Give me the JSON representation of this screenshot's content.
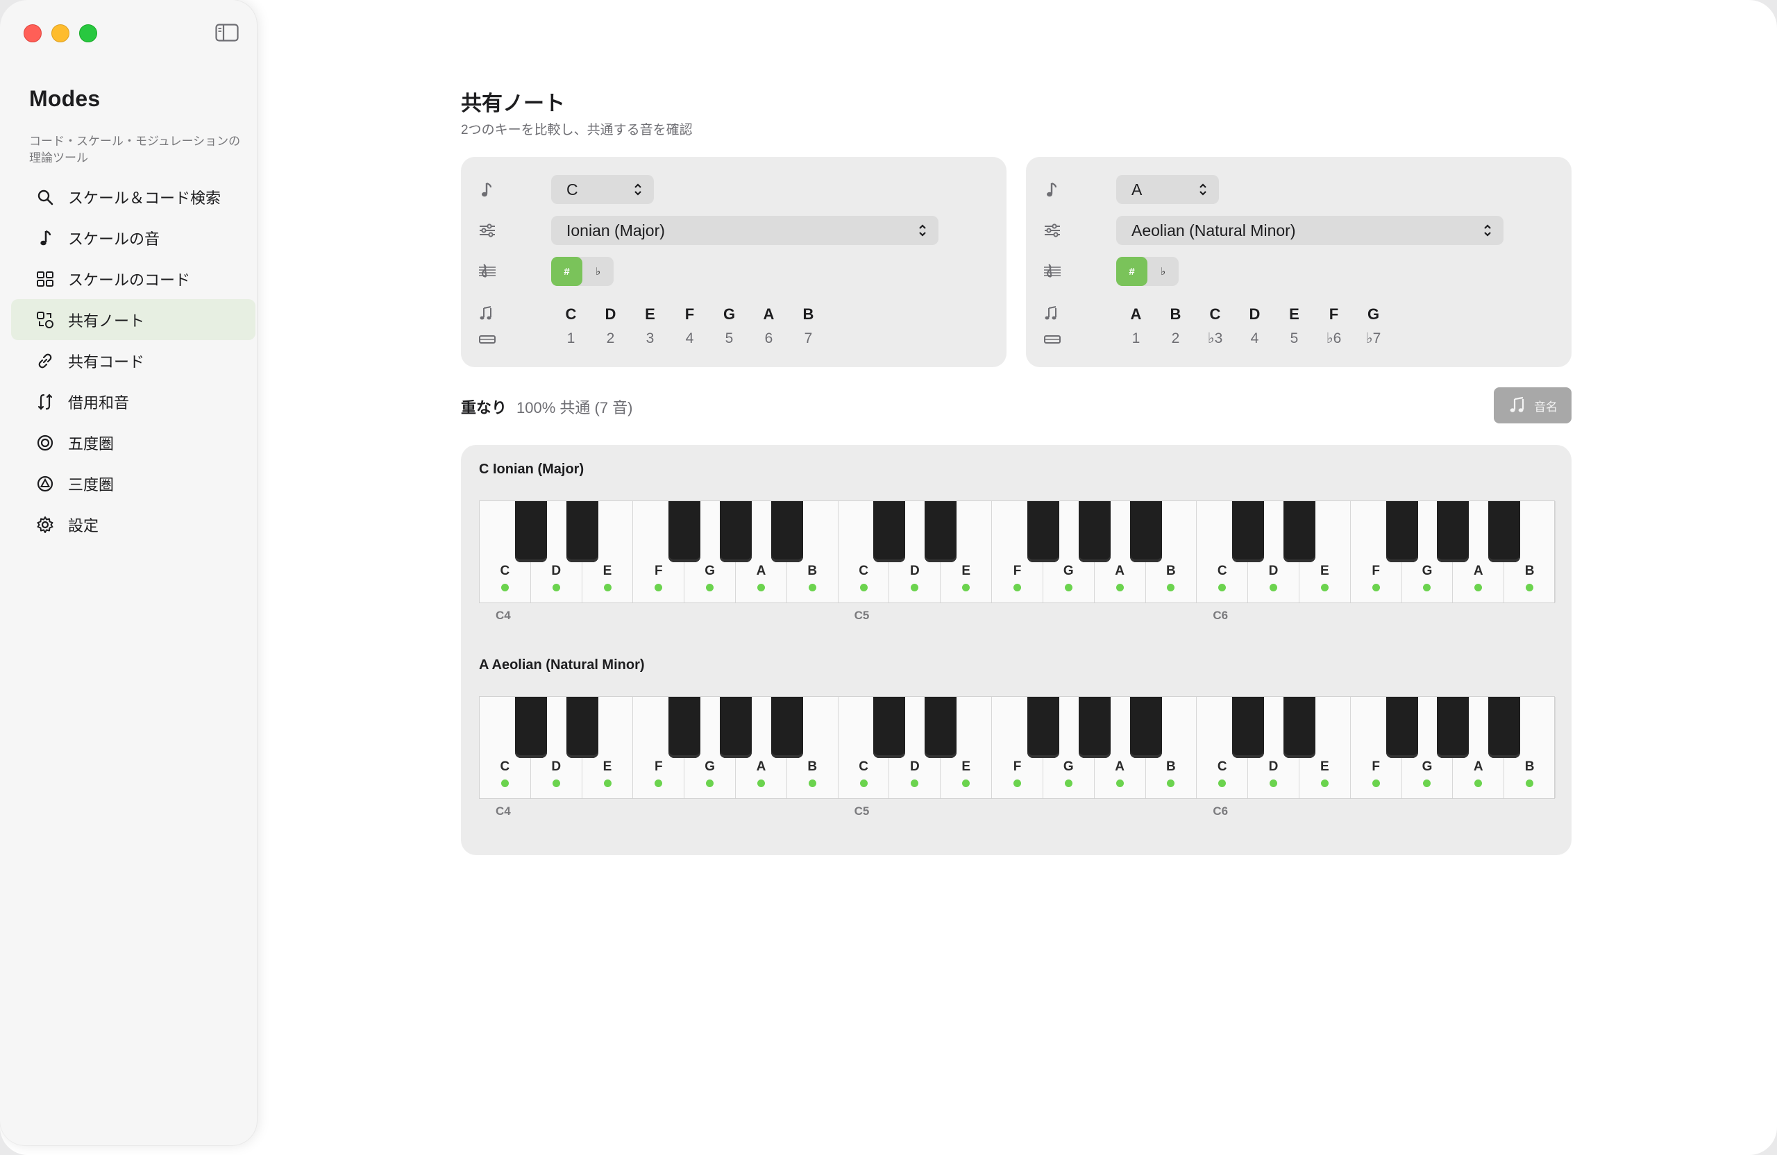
{
  "app": {
    "title": "Modes",
    "subtitle": "コード・スケール・モジュレーションの理論ツール"
  },
  "sidebar": {
    "items": [
      {
        "label": "スケール＆コード検索",
        "icon": "search-icon"
      },
      {
        "label": "スケールの音",
        "icon": "music-note-icon"
      },
      {
        "label": "スケールのコード",
        "icon": "grid-icon"
      },
      {
        "label": "共有ノート",
        "icon": "shared-shapes-icon",
        "active": true
      },
      {
        "label": "共有コード",
        "icon": "link-icon"
      },
      {
        "label": "借用和音",
        "icon": "swap-arrows-icon"
      },
      {
        "label": "五度圏",
        "icon": "circle-target-icon"
      },
      {
        "label": "三度圏",
        "icon": "triangle-circle-icon"
      },
      {
        "label": "設定",
        "icon": "gear-icon"
      }
    ]
  },
  "main": {
    "title": "共有ノート",
    "subtitle": "2つのキーを比較し、共通する音を確認"
  },
  "key_left": {
    "root": "C",
    "mode": "Ionian (Major)",
    "sharp_label": "#",
    "flat_label": "♭",
    "notes": [
      "C",
      "D",
      "E",
      "F",
      "G",
      "A",
      "B"
    ],
    "degrees": [
      "1",
      "2",
      "3",
      "4",
      "5",
      "6",
      "7"
    ]
  },
  "key_right": {
    "root": "A",
    "mode": "Aeolian (Natural Minor)",
    "sharp_label": "#",
    "flat_label": "♭",
    "notes": [
      "A",
      "B",
      "C",
      "D",
      "E",
      "F",
      "G"
    ],
    "degrees": [
      "1",
      "2",
      "♭3",
      "4",
      "5",
      "♭6",
      "♭7"
    ]
  },
  "overlap": {
    "label": "重なり",
    "value": "100% 共通 (7 音)",
    "names_button": "音名"
  },
  "keyboards": [
    {
      "title": "C Ionian (Major)",
      "white_keys": [
        "C",
        "D",
        "E",
        "F",
        "G",
        "A",
        "B",
        "C",
        "D",
        "E",
        "F",
        "G",
        "A",
        "B",
        "C",
        "D",
        "E",
        "F",
        "G",
        "A",
        "B"
      ],
      "highlighted": [
        true,
        true,
        true,
        true,
        true,
        true,
        true,
        true,
        true,
        true,
        true,
        true,
        true,
        true,
        true,
        true,
        true,
        true,
        true,
        true,
        true
      ],
      "octave_labels": [
        "C4",
        "C5",
        "C6"
      ]
    },
    {
      "title": "A Aeolian (Natural Minor)",
      "white_keys": [
        "C",
        "D",
        "E",
        "F",
        "G",
        "A",
        "B",
        "C",
        "D",
        "E",
        "F",
        "G",
        "A",
        "B",
        "C",
        "D",
        "E",
        "F",
        "G",
        "A",
        "B"
      ],
      "highlighted": [
        true,
        true,
        true,
        true,
        true,
        true,
        true,
        true,
        true,
        true,
        true,
        true,
        true,
        true,
        true,
        true,
        true,
        true,
        true,
        true,
        true
      ],
      "octave_labels": [
        "C4",
        "C5",
        "C6"
      ]
    }
  ],
  "colors": {
    "accent_green": "#7ac35a",
    "dot_green": "#6bd34e",
    "active_nav_bg": "#e7efe2"
  }
}
